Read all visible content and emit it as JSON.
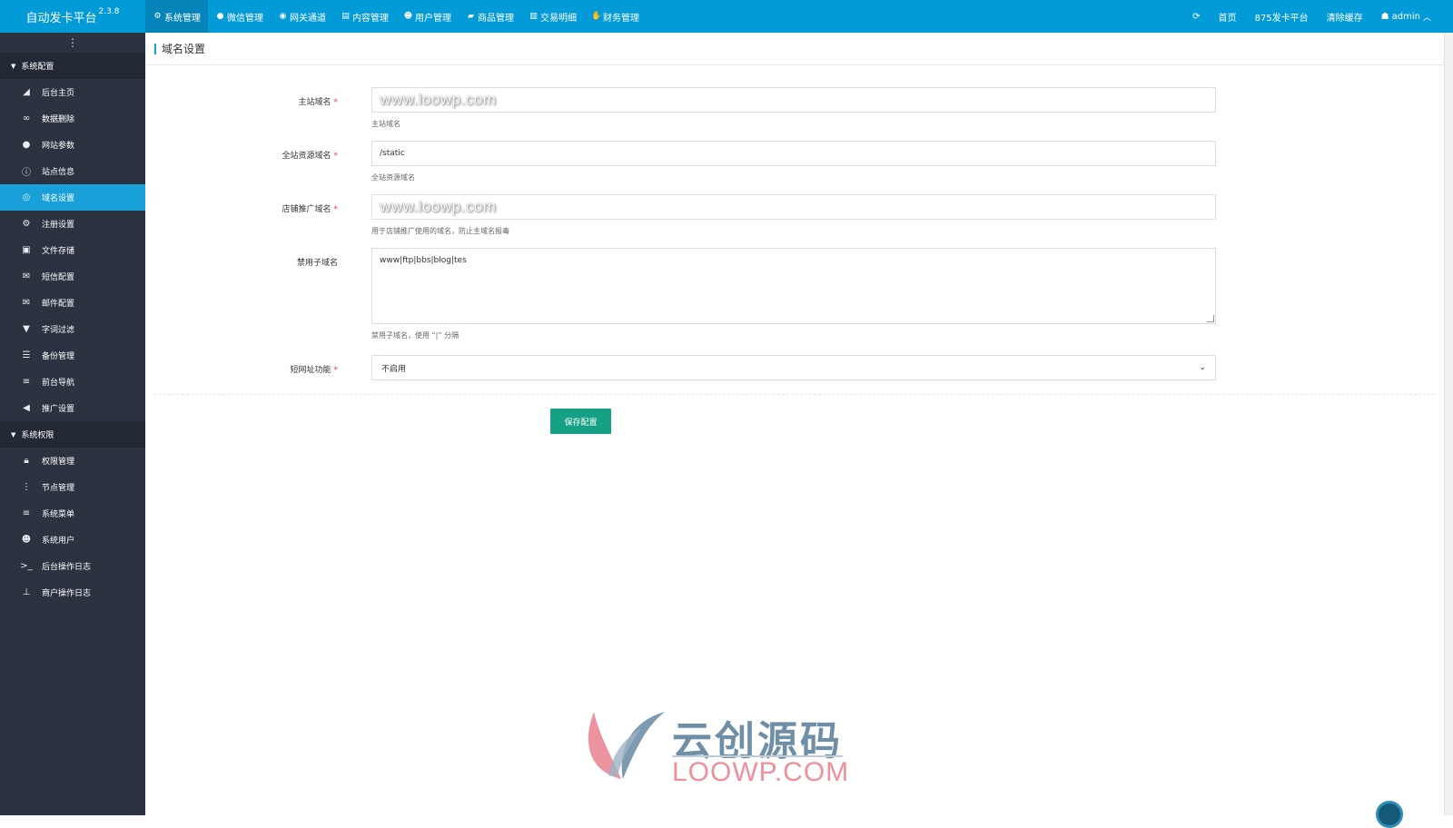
{
  "brand": {
    "name": "自动发卡平台",
    "version": "2.3.8"
  },
  "top_nav": [
    {
      "label": "系统管理",
      "icon": "gear-icon",
      "active": true
    },
    {
      "label": "微信管理",
      "icon": "wechat-icon"
    },
    {
      "label": "网关通道",
      "icon": "gateway-icon"
    },
    {
      "label": "内容管理",
      "icon": "document-icon"
    },
    {
      "label": "用户管理",
      "icon": "users-icon"
    },
    {
      "label": "商品管理",
      "icon": "shop-icon"
    },
    {
      "label": "交易明细",
      "icon": "bar-chart-icon"
    },
    {
      "label": "财务管理",
      "icon": "finance-icon"
    }
  ],
  "top_right": {
    "refresh_icon": "refresh-icon",
    "home": "首页",
    "site": "875发卡平台",
    "clear_cache": "清除缓存",
    "user": "admin"
  },
  "sidebar": {
    "groups": [
      {
        "label": "系统配置",
        "items": [
          {
            "label": "后台主页",
            "icon": "area-chart-icon"
          },
          {
            "label": "数据删除",
            "icon": "link-icon"
          },
          {
            "label": "网站参数",
            "icon": "apple-icon"
          },
          {
            "label": "站点信息",
            "icon": "info-icon"
          },
          {
            "label": "域名设置",
            "icon": "globe-icon",
            "active": true
          },
          {
            "label": "注册设置",
            "icon": "gear-icon"
          },
          {
            "label": "文件存储",
            "icon": "floppy-icon"
          },
          {
            "label": "短信配置",
            "icon": "envelope-icon"
          },
          {
            "label": "邮件配置",
            "icon": "envelope-icon"
          },
          {
            "label": "字词过滤",
            "icon": "filter-icon"
          },
          {
            "label": "备份管理",
            "icon": "database-icon"
          },
          {
            "label": "前台导航",
            "icon": "bars-icon"
          },
          {
            "label": "推广设置",
            "icon": "bullhorn-icon"
          }
        ]
      },
      {
        "label": "系统权限",
        "items": [
          {
            "label": "权限管理",
            "icon": "lock-icon"
          },
          {
            "label": "节点管理",
            "icon": "ellipsis-vertical-icon"
          },
          {
            "label": "系统菜单",
            "icon": "bars-icon"
          },
          {
            "label": "系统用户",
            "icon": "users-icon"
          },
          {
            "label": "后台操作日志",
            "icon": "terminal-icon"
          },
          {
            "label": "商户操作日志",
            "icon": "pin-icon"
          }
        ]
      }
    ]
  },
  "page": {
    "title": "域名设置",
    "fields": [
      {
        "label": "主站域名",
        "required": true,
        "value": "www.loowp.com",
        "help": "主站域名"
      },
      {
        "label": "全站资源域名",
        "required": true,
        "value": "/static",
        "help": "全站资源域名"
      },
      {
        "label": "店铺推广域名",
        "required": true,
        "value": "www.loowp.com",
        "help": "用于店铺推广使用的域名，防止主域名报毒"
      },
      {
        "label": "禁用子域名",
        "required": false,
        "value": "www|ftp|bbs|blog|tes",
        "help": "禁用子域名，使用 “|” 分隔"
      },
      {
        "label": "短网址功能",
        "required": true,
        "value": "不启用"
      }
    ],
    "save_label": "保存配置"
  },
  "watermark": {
    "cn": "云创源码",
    "en": "LOOWP.COM"
  },
  "colors": {
    "topbar": "#039ad8",
    "sidebar": "#2b3341",
    "active": "#1aa0d8",
    "save": "#16a085"
  }
}
